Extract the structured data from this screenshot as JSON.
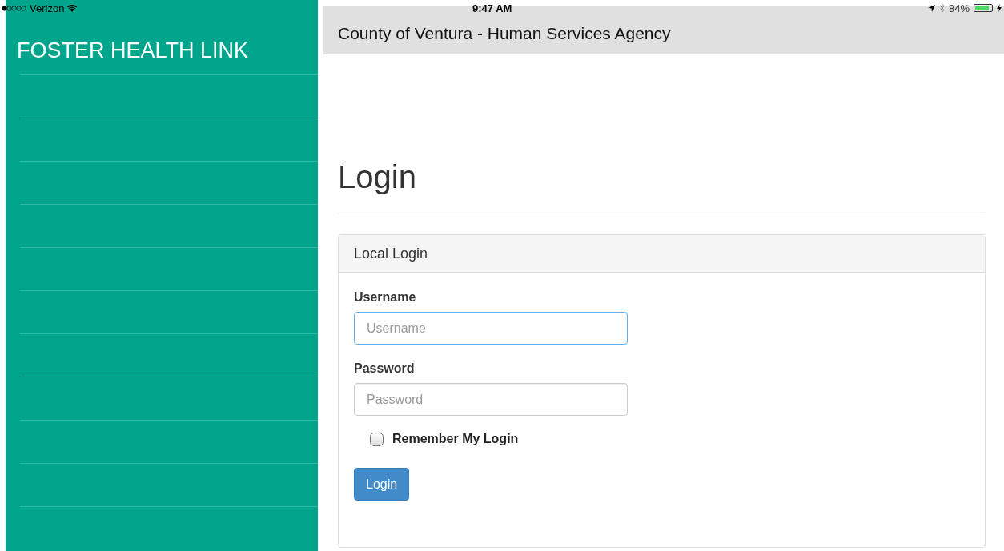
{
  "status_bar": {
    "carrier": "Verizon",
    "time": "9:47 AM",
    "battery": "84%"
  },
  "sidebar": {
    "title": "FOSTER HEALTH LINK"
  },
  "header": {
    "title": "County of Ventura - Human Services Agency"
  },
  "page": {
    "heading": "Login"
  },
  "panel": {
    "title": "Local Login",
    "fields": [
      {
        "label": "Username",
        "placeholder": "Username",
        "focused": true
      },
      {
        "label": "Password",
        "placeholder": "Password",
        "focused": false
      }
    ],
    "remember": {
      "label": "Remember My Login",
      "checked": false
    },
    "button": "Login"
  }
}
